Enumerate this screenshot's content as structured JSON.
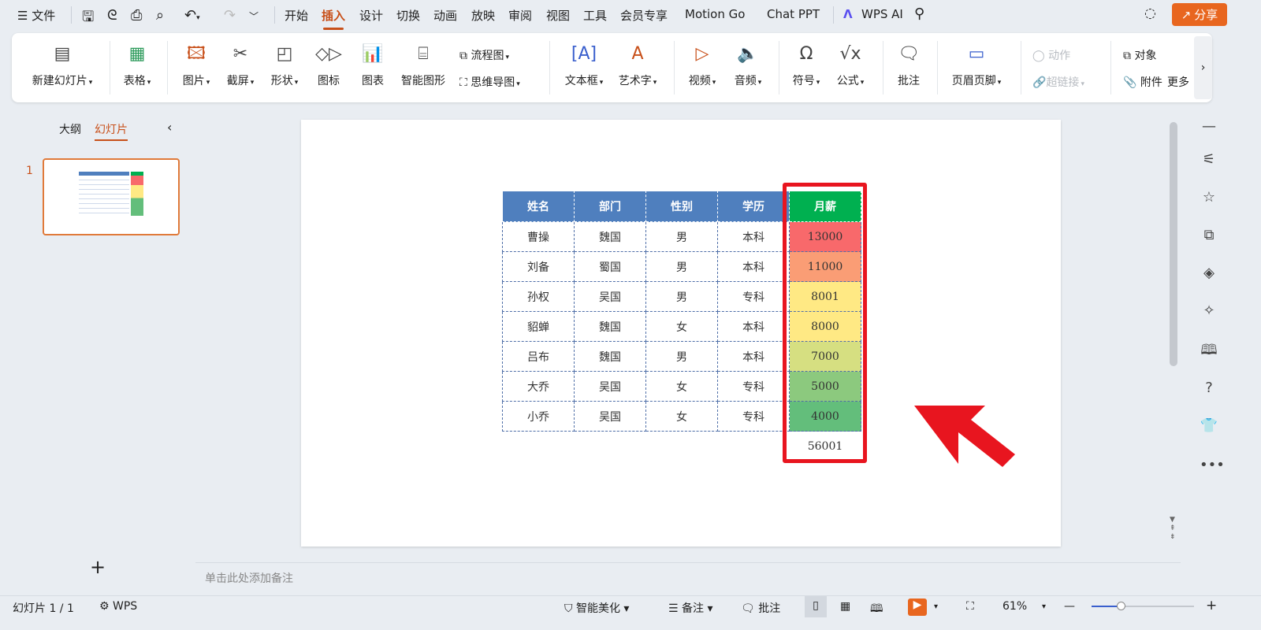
{
  "titlebar": {
    "menu": "文件",
    "tabs": [
      "开始",
      "插入",
      "设计",
      "切换",
      "动画",
      "放映",
      "审阅",
      "视图",
      "工具",
      "会员专享",
      "Motion Go",
      "Chat PPT"
    ],
    "active_tab": "插入",
    "wps_ai": "WPS AI",
    "share": "分享"
  },
  "ribbon": {
    "new_slide": "新建幻灯片",
    "table": "表格",
    "picture": "图片",
    "screenshot": "截屏",
    "shape": "形状",
    "icon": "图标",
    "chart": "图表",
    "smartart": "智能图形",
    "flowchart": "流程图",
    "mindmap": "思维导图",
    "textbox": "文本框",
    "wordart": "艺术字",
    "video": "视频",
    "audio": "音频",
    "symbol": "符号",
    "formula": "公式",
    "comment": "批注",
    "header_footer": "页眉页脚",
    "action": "动作",
    "hyperlink": "超链接",
    "object": "对象",
    "attachment": "附件",
    "more": "更多"
  },
  "left_panel": {
    "tab_outline": "大纲",
    "tab_slides": "幻灯片",
    "slide_number": "1",
    "add": "+"
  },
  "table": {
    "headers": [
      "姓名",
      "部门",
      "性别",
      "学历",
      "月薪"
    ],
    "rows": [
      [
        "曹操",
        "魏国",
        "男",
        "本科",
        "13000"
      ],
      [
        "刘备",
        "蜀国",
        "男",
        "本科",
        "11000"
      ],
      [
        "孙权",
        "吴国",
        "男",
        "专科",
        "8001"
      ],
      [
        "貂蝉",
        "魏国",
        "女",
        "本科",
        "8000"
      ],
      [
        "吕布",
        "魏国",
        "男",
        "本科",
        "7000"
      ],
      [
        "大乔",
        "吴国",
        "女",
        "专科",
        "5000"
      ],
      [
        "小乔",
        "吴国",
        "女",
        "专科",
        "4000"
      ]
    ],
    "total": "56001",
    "salary_colors": [
      "#f8696b",
      "#fa9d75",
      "#ffe984",
      "#ffe984",
      "#d6df81",
      "#8cc97e",
      "#63be7b"
    ],
    "header_color": "#4f7fbe",
    "salary_header_color": "#00b050",
    "highlight_color": "#e8151f"
  },
  "notes": {
    "placeholder": "单击此处添加备注"
  },
  "statusbar": {
    "slide_info": "幻灯片 1 / 1",
    "wps": "WPS",
    "beautify": "智能美化",
    "notes": "备注",
    "comment": "批注",
    "zoom": "61%",
    "zoom_level": 61
  }
}
